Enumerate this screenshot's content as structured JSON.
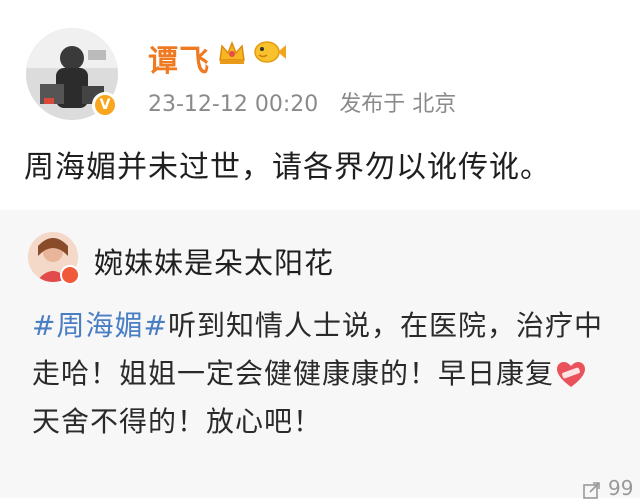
{
  "post": {
    "username": "谭飞",
    "timestamp": "23-12-12 00:20",
    "location": "发布于 北京",
    "text": "周海媚并未过世，请各界勿以讹传讹。",
    "icons": [
      "crown-icon",
      "fish-icon",
      "verified-badge-icon"
    ]
  },
  "repost": {
    "username": "婉妹妹是朵太阳花",
    "hashtag": "#周海媚#",
    "line1": "听到知情人士说，在医院，治疗中",
    "line2": "走哈！姐姐一定会健健康康的！早日康复",
    "line3": "天舍不得的！放心吧！",
    "counter": "99"
  },
  "colors": {
    "username": "#ef7a22",
    "hashtag": "#4a7ec3",
    "meta": "#8a8a8a",
    "repost_bg": "#f7f7f7"
  }
}
